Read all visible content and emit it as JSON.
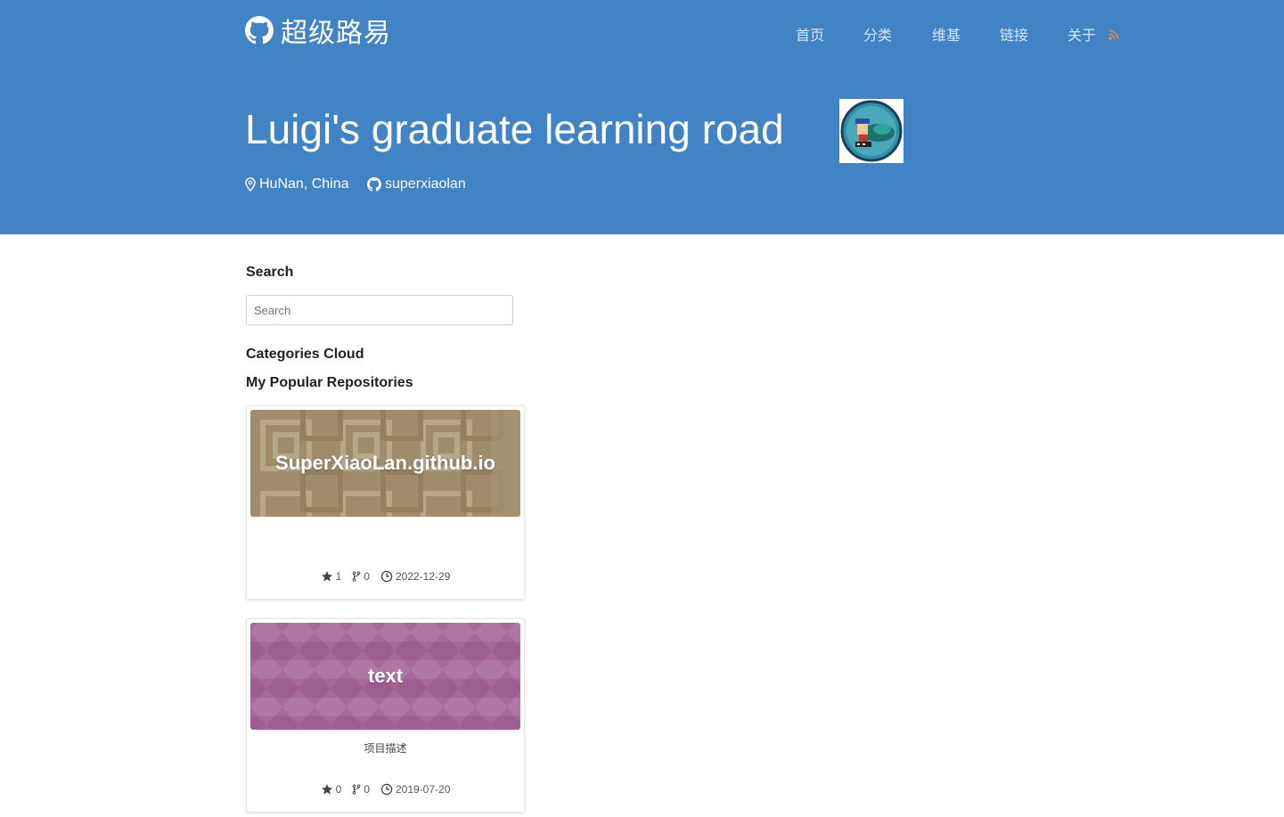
{
  "site": {
    "brand": "超级路易",
    "nav": [
      {
        "label": "首页"
      },
      {
        "label": "分类"
      },
      {
        "label": "维基"
      },
      {
        "label": "链接"
      },
      {
        "label": "关于"
      }
    ],
    "title": "Luigi's graduate learning road",
    "location": "HuNan, China",
    "github_user": "superxiaolan"
  },
  "sidebar": {
    "search_title": "Search",
    "search_placeholder": "Search",
    "categories_title": "Categories Cloud",
    "repos_title": "My Popular Repositories"
  },
  "repos": [
    {
      "name": "SuperXiaoLan.github.io",
      "description": "",
      "stars": "1",
      "forks": "0",
      "updated": "2022-12-29",
      "banner_color": "#a08c6c"
    },
    {
      "name": "text",
      "description": "项目描述",
      "stars": "0",
      "forks": "0",
      "updated": "2019-07-20",
      "banner_color": "#a8699a"
    }
  ],
  "colors": {
    "header": "#4183c4",
    "rss": "#f0883e"
  }
}
